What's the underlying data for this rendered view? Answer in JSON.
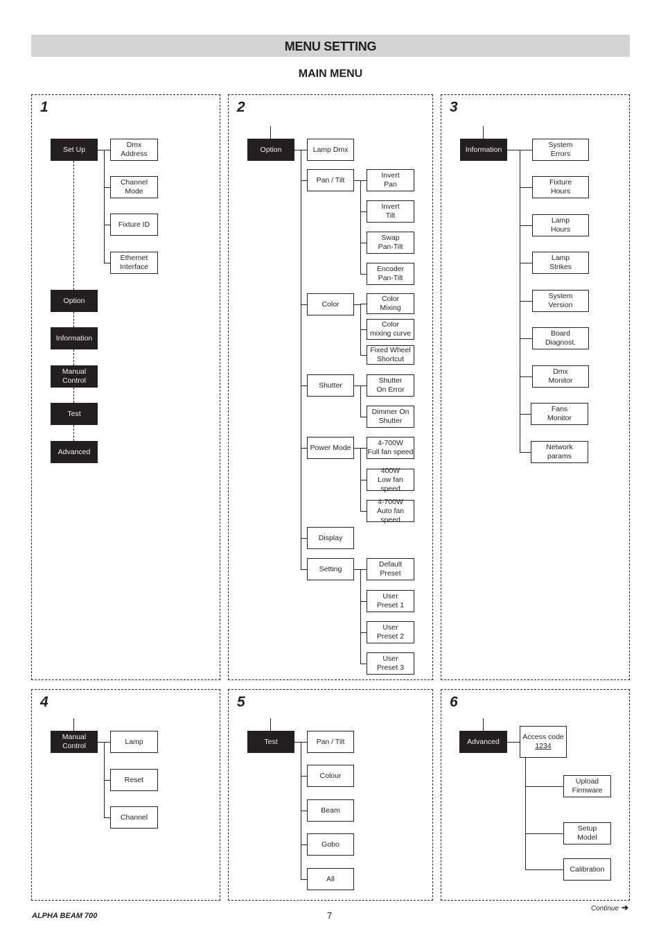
{
  "header": {
    "title": "MENU SETTING",
    "subtitle": "MAIN MENU"
  },
  "panels": [
    {
      "number": "1",
      "root": "Set Up",
      "children": [
        "Dmx\nAddress",
        "Channel\nMode",
        "Fixture ID",
        "Ethernet\nInterface"
      ],
      "main_menu_sequence": [
        "Option",
        "Information",
        "Manual\nControl",
        "Test",
        "Advanced"
      ]
    },
    {
      "number": "2",
      "root": "Option",
      "children": [
        {
          "label": "Lamp Dmx",
          "children": []
        },
        {
          "label": "Pan / Tilt",
          "children": [
            "Invert\nPan",
            "Invert\nTilt",
            "Swap\nPan-Tilt",
            "Encoder\nPan-Tilt"
          ]
        },
        {
          "label": "Color",
          "children": [
            "Color\nMixing",
            "Color\nmixing curve",
            "Fixed Wheel\nShortcut"
          ]
        },
        {
          "label": "Shutter",
          "children": [
            "Shutter\nOn Error",
            "Dimmer On\nShutter"
          ]
        },
        {
          "label": "Power Mode",
          "children": [
            "4-700W\nFull fan speed",
            "400W\nLow fan speed",
            "4-700W\nAuto fan speed"
          ]
        },
        {
          "label": "Display",
          "children": []
        },
        {
          "label": "Setting",
          "children": [
            "Default\nPreset",
            "User\nPreset 1",
            "User\nPreset 2",
            "User\nPreset 3"
          ]
        }
      ]
    },
    {
      "number": "3",
      "root": "Information",
      "children": [
        "System\nErrors",
        "Fixture\nHours",
        "Lamp\nHours",
        "Lamp\nStrikes",
        "System\nVersion",
        "Board\nDiagnost.",
        "Dmx\nMonitor",
        "Fans\nMonitor",
        "Network\nparams"
      ]
    },
    {
      "number": "4",
      "root": "Manual\nControl",
      "children": [
        "Lamp",
        "Reset",
        "Channel"
      ]
    },
    {
      "number": "5",
      "root": "Test",
      "children": [
        "Pan / Tilt",
        "Colour",
        "Beam",
        "Gobo",
        "All"
      ]
    },
    {
      "number": "6",
      "root": "Advanced",
      "access": {
        "label": "Access code",
        "code": "1234"
      },
      "children": [
        "Upload\nFirmware",
        "Setup\nModel",
        "Calibration"
      ]
    }
  ],
  "footer": {
    "product": "ALPHA BEAM 700",
    "page": "7",
    "continue": "Continue",
    "continue_icon": "arrow-right-icon"
  }
}
